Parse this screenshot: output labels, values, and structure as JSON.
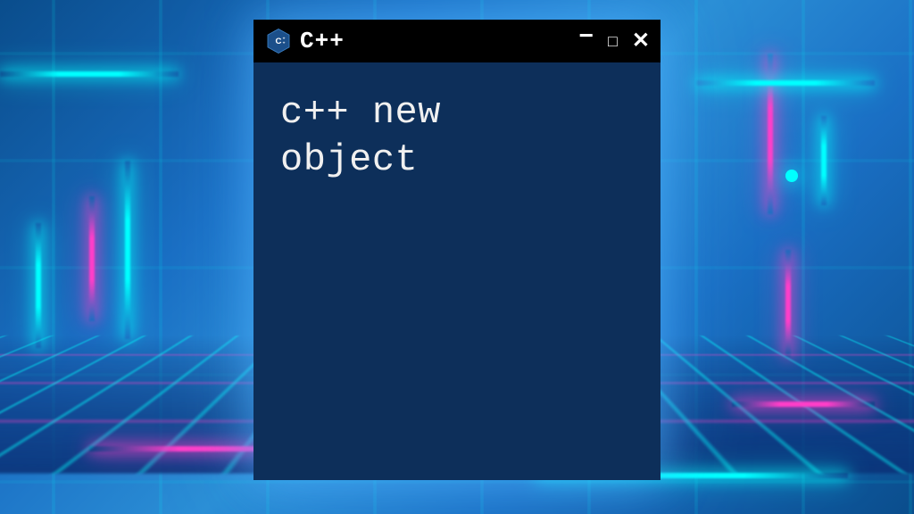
{
  "window": {
    "title": "C++",
    "icon_name": "cpp-hexagon-icon",
    "controls": {
      "minimize": "−",
      "maximize": "□",
      "close": "✕"
    }
  },
  "terminal": {
    "content": "c++ new\nobject"
  },
  "colors": {
    "titlebar_bg": "#000000",
    "body_bg": "#0d2f5a",
    "text": "#f0f0f0",
    "neon_pink": "#ff3ec9",
    "neon_cyan": "#00ffff"
  }
}
